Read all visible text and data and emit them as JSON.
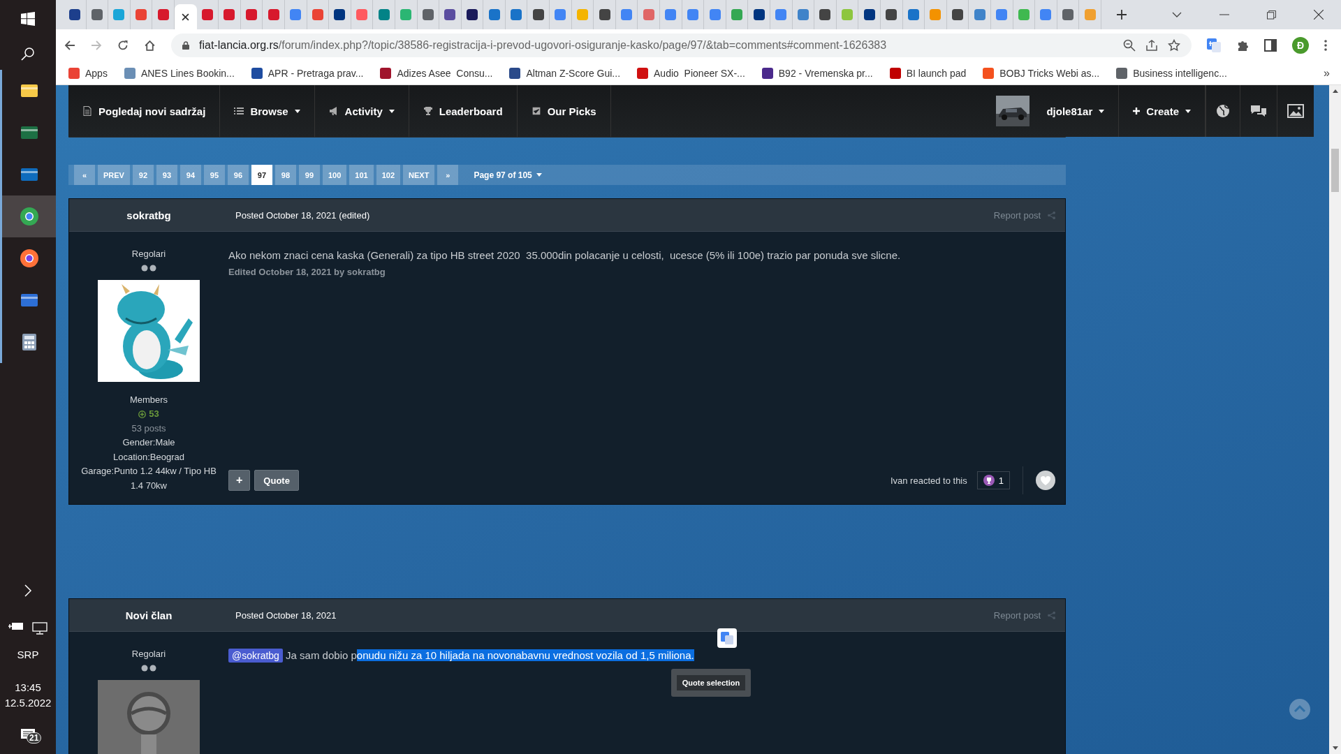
{
  "taskbar": {
    "apps": [
      {
        "kind": "explorer",
        "selected": false
      },
      {
        "kind": "excel",
        "selected": false
      },
      {
        "kind": "outlook",
        "selected": false
      },
      {
        "kind": "chrome",
        "selected": true
      },
      {
        "kind": "firefox",
        "selected": false
      },
      {
        "kind": "stack",
        "selected": false
      },
      {
        "kind": "calculator",
        "selected": false
      }
    ],
    "language": "SRP",
    "time": "13:45",
    "date": "12.5.2022",
    "notifications": "21"
  },
  "browser": {
    "tabs": [
      {
        "color": "#1d3f8c",
        "selected": false
      },
      {
        "color": "#5f6368",
        "selected": false
      },
      {
        "color": "#1aa6d8",
        "selected": false
      },
      {
        "color": "#ea4335",
        "selected": false
      },
      {
        "color": "#d7192d",
        "selected": false
      },
      {
        "selected": true
      },
      {
        "color": "#d7192d",
        "selected": false
      },
      {
        "color": "#d7192d",
        "selected": false
      },
      {
        "color": "#d7192d",
        "selected": false
      },
      {
        "color": "#d7192d",
        "selected": false
      },
      {
        "color": "#4285f4",
        "selected": false
      },
      {
        "color": "#ea4335",
        "selected": false
      },
      {
        "color": "#003580",
        "selected": false
      },
      {
        "color": "#ff5a5f",
        "selected": false
      },
      {
        "color": "#038387",
        "selected": false
      },
      {
        "color": "#2bb673",
        "selected": false
      },
      {
        "color": "#5f6368",
        "selected": false
      },
      {
        "color": "#5b4ea0",
        "selected": false
      },
      {
        "color": "#1a1a5a",
        "selected": false
      },
      {
        "color": "#1a73c8",
        "selected": false
      },
      {
        "color": "#1a73c8",
        "selected": false
      },
      {
        "color": "#444444",
        "selected": false
      },
      {
        "color": "#4285f4",
        "selected": false
      },
      {
        "color": "#f4b400",
        "selected": false
      },
      {
        "color": "#444444",
        "selected": false
      },
      {
        "color": "#4285f4",
        "selected": false
      },
      {
        "color": "#e06666",
        "selected": false
      },
      {
        "color": "#4285f4",
        "selected": false
      },
      {
        "color": "#4285f4",
        "selected": false
      },
      {
        "color": "#4285f4",
        "selected": false
      },
      {
        "color": "#34a853",
        "selected": false
      },
      {
        "color": "#003580",
        "selected": false
      },
      {
        "color": "#4285f4",
        "selected": false
      },
      {
        "color": "#3f83c9",
        "selected": false
      },
      {
        "color": "#444444",
        "selected": false
      },
      {
        "color": "#8dc63f",
        "selected": false
      },
      {
        "color": "#003580",
        "selected": false
      },
      {
        "color": "#444444",
        "selected": false
      },
      {
        "color": "#1a73c8",
        "selected": false
      },
      {
        "color": "#f39200",
        "selected": false
      },
      {
        "color": "#444444",
        "selected": false
      },
      {
        "color": "#3f83c9",
        "selected": false
      },
      {
        "color": "#4285f4",
        "selected": false
      },
      {
        "color": "#3fb950",
        "selected": false
      },
      {
        "color": "#4285f4",
        "selected": false
      },
      {
        "color": "#5f6368",
        "selected": false
      },
      {
        "color": "#f0a030",
        "selected": false
      }
    ],
    "url_host": "fiat-lancia.org.rs",
    "url_path": "/forum/index.php?/topic/38586-registracija-i-prevod-ugovori-osiguranje-kasko/page/97/&tab=comments#comment-1626383",
    "profile_initial": "Đ",
    "bookmarks": [
      {
        "label": "Apps",
        "color": "#ea4335"
      },
      {
        "label": "ANES Lines Bookin...",
        "color": "#6b8fb5"
      },
      {
        "label": "APR - Pretraga prav...",
        "color": "#1e4ca0"
      },
      {
        "label": "Adizes Asee  Consu...",
        "color": "#a0142c"
      },
      {
        "label": "Altman Z-Score Gui...",
        "color": "#2a4a8a"
      },
      {
        "label": "Audio  Pioneer SX-...",
        "color": "#d01010"
      },
      {
        "label": "B92 - Vremenska pr...",
        "color": "#4b2a8c"
      },
      {
        "label": "BI launch pad",
        "color": "#c00000"
      },
      {
        "label": "BOBJ Tricks Webi as...",
        "color": "#f4511e"
      },
      {
        "label": "Business intelligenc...",
        "color": "#5f6368"
      }
    ],
    "bookmarks_more": "»"
  },
  "forum_nav": {
    "items": [
      {
        "label": "Pogledaj novi sadržaj",
        "kind": "document",
        "has_menu": false
      },
      {
        "label": "Browse",
        "kind": "list",
        "has_menu": true
      },
      {
        "label": "Activity",
        "kind": "megaphone",
        "has_menu": true
      },
      {
        "label": "Leaderboard",
        "kind": "trophy",
        "has_menu": false
      },
      {
        "label": "Our Picks",
        "kind": "check",
        "has_menu": false
      }
    ],
    "user": "djole81ar",
    "create": "Create"
  },
  "pagination": {
    "first": "«",
    "prev": "PREV",
    "pages": [
      {
        "label": "92",
        "selected": false
      },
      {
        "label": "93",
        "selected": false
      },
      {
        "label": "94",
        "selected": false
      },
      {
        "label": "95",
        "selected": false
      },
      {
        "label": "96",
        "selected": false
      },
      {
        "label": "97",
        "selected": true
      },
      {
        "label": "98",
        "selected": false
      },
      {
        "label": "99",
        "selected": false
      },
      {
        "label": "100",
        "selected": false
      },
      {
        "label": "101",
        "selected": false
      },
      {
        "label": "102",
        "selected": false
      }
    ],
    "next": "NEXT",
    "last": "»",
    "page_info": "Page 97 of 105"
  },
  "posts": [
    {
      "author": "sokratbg",
      "date": "Posted October 18, 2021 (edited)",
      "report": "Report post",
      "rank": "Regolari",
      "custom_avatar": true,
      "group": "Members",
      "reputation": "53",
      "post_count": "53 posts",
      "info": [
        "Gender:Male",
        "Location:Beograd",
        "Garage:Punto 1.2 44kw / Tipo HB 1.4 70kw"
      ],
      "body": [
        {
          "kind": "text",
          "text": "Ako nekom znaci cena kaska (Generali) za tipo HB street 2020  35.000din polacanje u celosti,  ucesce (5% ili 100e) trazio par ponuda sve slicne."
        }
      ],
      "edited": "Edited October 18, 2021 by sokratbg",
      "add": "+",
      "quote": "Quote",
      "reaction": "Ivan reacted to this",
      "reaction_count": "1"
    },
    {
      "author": "Novi član",
      "date": "Posted October 18, 2021",
      "report": "Report post",
      "rank": "Regolari",
      "custom_avatar": false,
      "body": [
        {
          "kind": "mention",
          "text": "@sokratbg"
        },
        {
          "kind": "text",
          "text": " Ja sam dobio p"
        },
        {
          "kind": "selected",
          "text": "onudu nižu za 10 hiljada na novonabavnu vrednost vozila od 1,5 miliona."
        }
      ],
      "selection_popup": "Quote selection"
    }
  ]
}
